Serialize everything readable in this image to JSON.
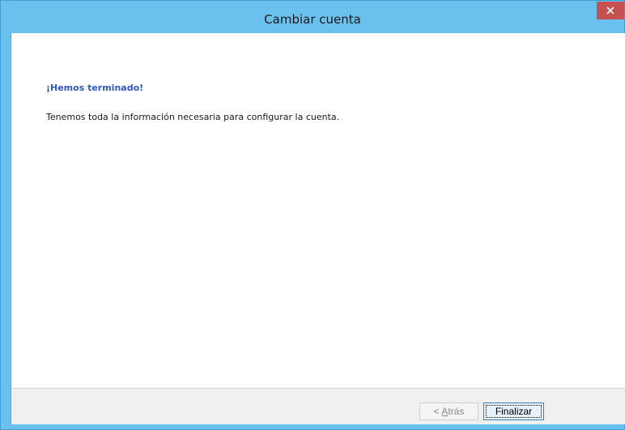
{
  "window": {
    "title": "Cambiar cuenta",
    "accent_color": "#6bc1ee",
    "close_color": "#c75050"
  },
  "content": {
    "heading": "¡Hemos terminado!",
    "heading_color": "#2e57c8",
    "description": "Tenemos toda la información necesaria para configurar la cuenta."
  },
  "footer": {
    "back_prefix": "< ",
    "back_accel": "A",
    "back_rest": "trás",
    "back_enabled": false,
    "finish_label": "Finalizar"
  },
  "icons": {
    "close": "close-icon"
  }
}
